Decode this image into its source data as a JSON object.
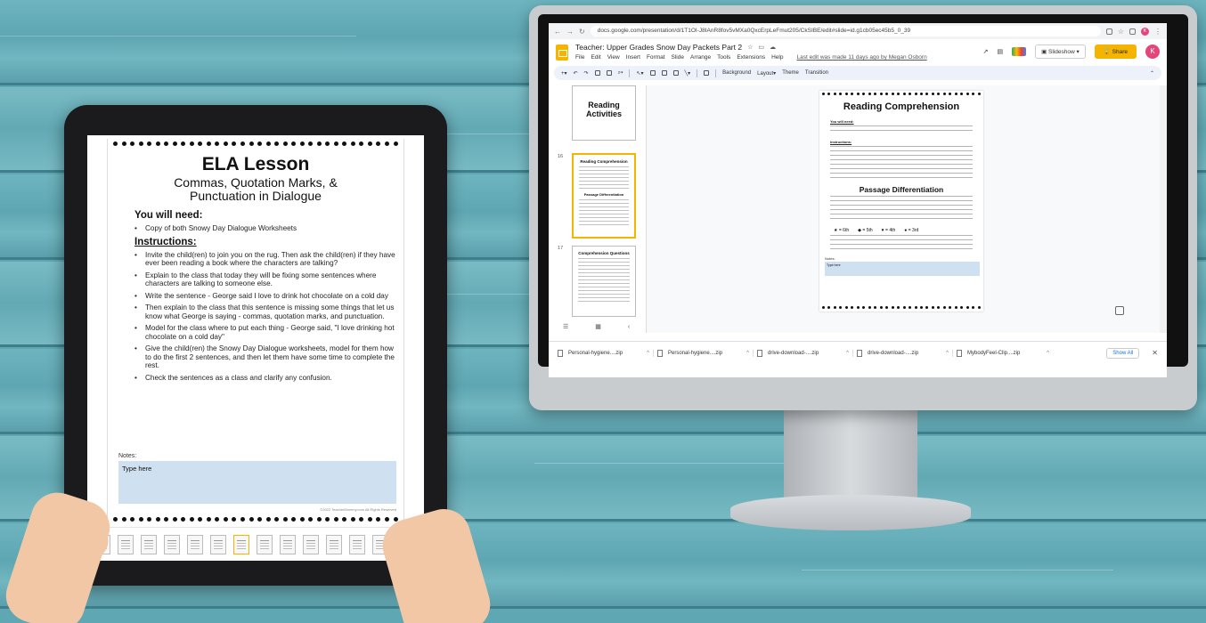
{
  "tablet": {
    "title": "ELA Lesson",
    "subtitle": "Commas, Quotation Marks, & Punctuation in Dialogue",
    "you_will_need_heading": "You will need:",
    "materials": [
      "Copy of both Snowy Day Dialogue Worksheets"
    ],
    "instructions_heading": "Instructions:",
    "instructions": [
      "Invite the child(ren) to join you on the rug. Then ask the child(ren) if they have ever been reading a book where the characters are talking?",
      "Explain to the class that today they will be fixing some sentences where characters are talking to someone else.",
      "Write the sentence - George said I love to drink hot chocolate on a cold day",
      "Then explain to the class that this sentence is missing some things that let us know what George is saying - commas, quotation marks, and punctuation.",
      "Model for the class where to put each thing - George said, \"I love drinking hot chocolate on a cold day\"",
      "Give the child(ren) the Snowy Day Dialogue worksheets, model for them how to do the first 2 sentences, and then let them have some time to complete the rest.",
      "Check the sentences as a class and clarify any confusion."
    ],
    "notes_label": "Notes:",
    "notes_placeholder": "Type here",
    "copyright": "©2022 TeacherMommy.com All Rights Reserved"
  },
  "browser": {
    "url": "docs.google.com/presentation/d/1T1OI-J8IAnR8fov5vMXa0QxcErpLeFmut205/CkSIBE/edit#slide=id.g1cb05ec45b5_0_39",
    "doc_title": "Teacher: Upper Grades Snow Day Packets Part 2",
    "menu": [
      "File",
      "Edit",
      "View",
      "Insert",
      "Format",
      "Slide",
      "Arrange",
      "Tools",
      "Extensions",
      "Help"
    ],
    "last_edit": "Last edit was made 11 days ago by Megan Osborn",
    "slideshow_label": "Slideshow",
    "share_label": "Share",
    "avatar_initial": "K",
    "toolbar": [
      "Background",
      "Layout▾",
      "Theme",
      "Transition"
    ],
    "filmstrip": [
      {
        "num": "",
        "title": "Reading Activities"
      },
      {
        "num": "16",
        "title": "Reading Comprehension",
        "sub": "Passage Differentiation"
      },
      {
        "num": "17",
        "title": "Comprehension Questions"
      }
    ],
    "slide": {
      "title": "Reading Comprehension",
      "you_will_need": "You will need:",
      "instructions": "Instructions:",
      "section": "Passage Differentiation",
      "levels": [
        "= 6th",
        "= 5th",
        "= 4th",
        "= 3rd"
      ],
      "notes_label": "Notes:",
      "notes_placeholder": "Type here"
    },
    "downloads": [
      "Personal-hygiene....zip",
      "Personal-hygiene....zip",
      "drive-download-....zip",
      "drive-download-....zip",
      "MybodyFeel-Clip....zip"
    ],
    "show_all": "Show All"
  },
  "colors": {
    "accent": "#f5b400",
    "notes_fill": "#cfe0f1",
    "background": "#5fa7b3"
  }
}
